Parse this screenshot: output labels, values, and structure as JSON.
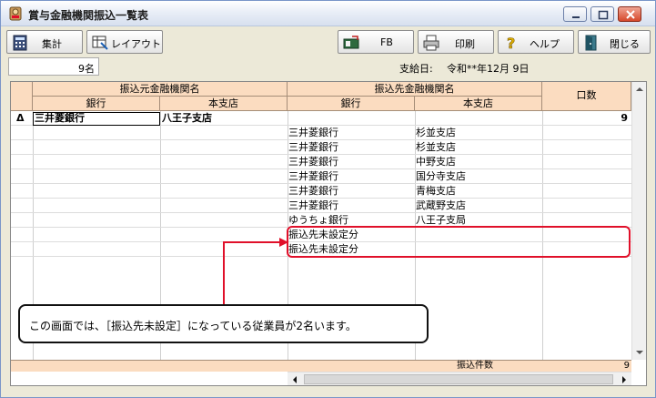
{
  "window": {
    "title": "賞与金融機関振込一覧表",
    "controls": [
      "minimize",
      "maximize",
      "close"
    ]
  },
  "toolbar": {
    "totals_label": "集計",
    "layout_label": "レイアウト",
    "fb_label": "FB",
    "print_label": "印刷",
    "help_label": "ヘルプ",
    "close_label": "閉じる"
  },
  "info": {
    "count": "9名",
    "pay_date_label": "支給日:",
    "pay_date_value": "令和**年12月 9日"
  },
  "grid": {
    "group_headers": {
      "source": "振込元金融機関名",
      "destination": "振込先金融機関名",
      "accounts": "口数"
    },
    "sub_headers": {
      "source_bank": "銀行",
      "source_branch": "本支店",
      "dest_bank": "銀行",
      "dest_branch": "本支店"
    },
    "group_row": {
      "marker": "Δ",
      "bank": "三井菱銀行",
      "branch": "八王子支店",
      "accounts": "9"
    },
    "rows": [
      {
        "bank": "三井菱銀行",
        "branch": "杉並支店"
      },
      {
        "bank": "三井菱銀行",
        "branch": "杉並支店"
      },
      {
        "bank": "三井菱銀行",
        "branch": "中野支店"
      },
      {
        "bank": "三井菱銀行",
        "branch": "国分寺支店"
      },
      {
        "bank": "三井菱銀行",
        "branch": "青梅支店"
      },
      {
        "bank": "三井菱銀行",
        "branch": "武蔵野支店"
      },
      {
        "bank": "ゆうちょ銀行",
        "branch": "八王子支局"
      },
      {
        "bank": "振込先未設定分",
        "branch": ""
      },
      {
        "bank": "振込先未設定分",
        "branch": ""
      }
    ],
    "footer": {
      "label": "振込件数",
      "value": "9"
    }
  },
  "callout": {
    "text": "この画面では、［振込先未設定］になっている従業員が2名います。"
  },
  "colors": {
    "header_bg": "#fbdcc0",
    "highlight": "#e0102a"
  }
}
